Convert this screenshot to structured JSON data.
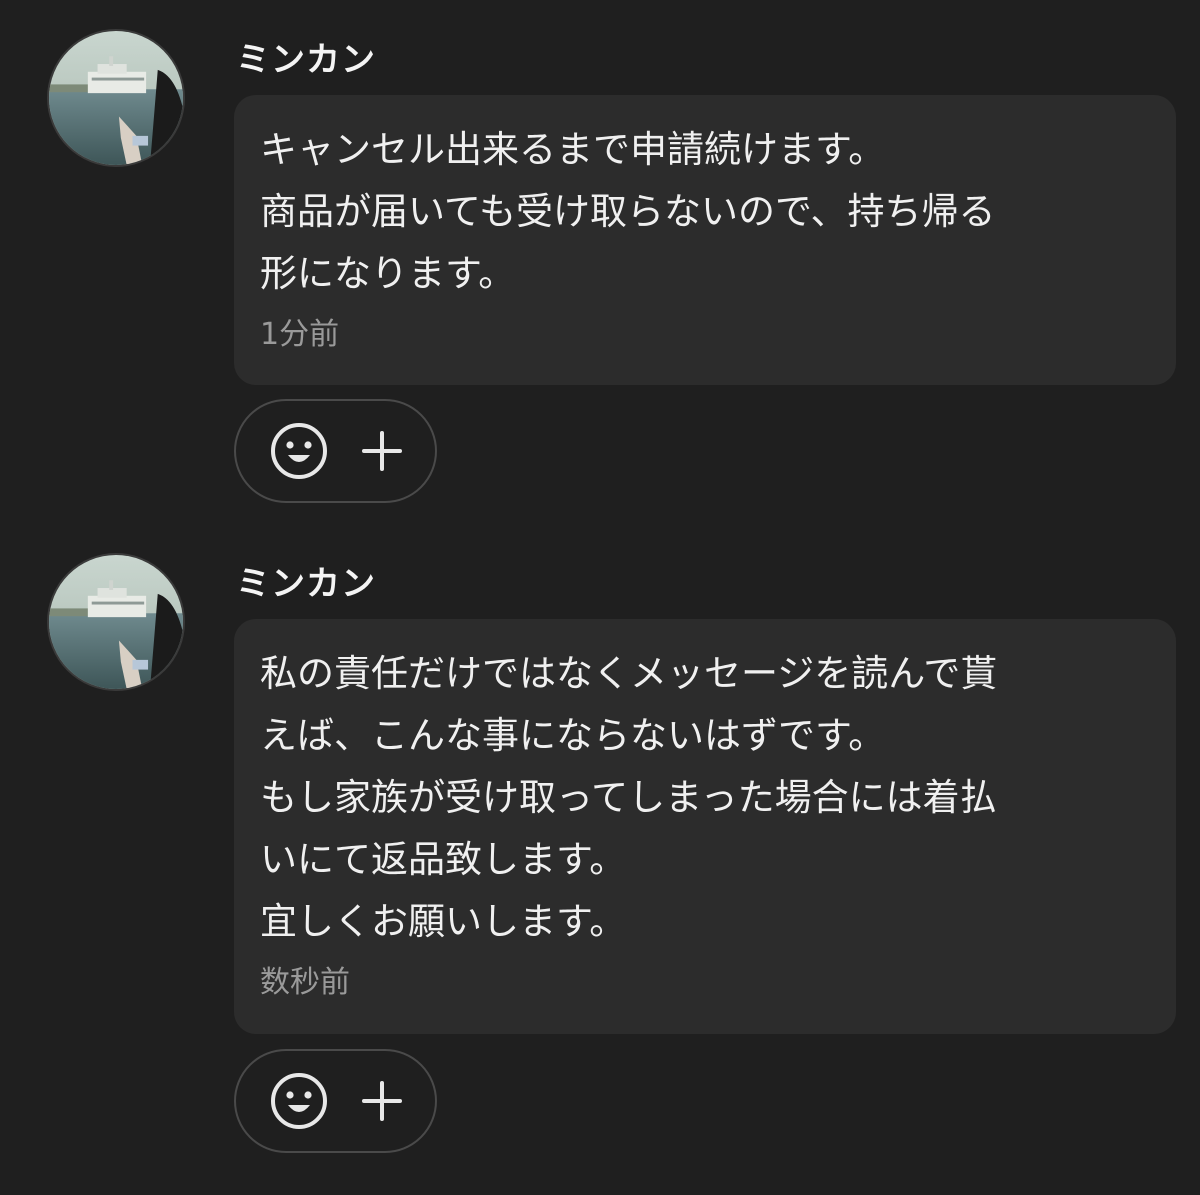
{
  "messages": [
    {
      "sender": "ミンカン",
      "lines": [
        "キャンセル出来るまで申請続けます。",
        "商品が届いても受け取らないので、持ち帰る",
        "形になります。"
      ],
      "timestamp": "1分前",
      "reactions": {
        "emoji_icon": "smiley-icon",
        "add_icon": "plus-icon"
      }
    },
    {
      "sender": "ミンカン",
      "lines": [
        "私の責任だけではなくメッセージを読んで貰",
        "えば、こんな事にならないはずです。",
        "もし家族が受け取ってしまった場合には着払",
        "いにて返品致します。",
        "宜しくお願いします。"
      ],
      "timestamp": "数秒前",
      "reactions": {
        "emoji_icon": "smiley-icon",
        "add_icon": "plus-icon"
      }
    }
  ],
  "colors": {
    "background": "#1f1f1f",
    "bubble": "#2c2c2c",
    "text": "#f0f0f0",
    "timestamp": "#9a9a9a",
    "pill_border": "#4a4a4a"
  }
}
